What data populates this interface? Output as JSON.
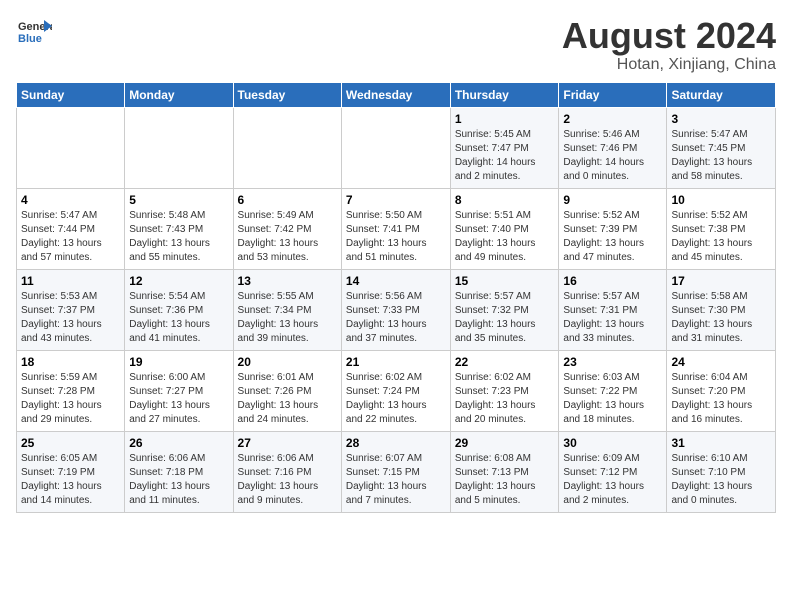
{
  "header": {
    "logo_general": "General",
    "logo_blue": "Blue",
    "title": "August 2024",
    "subtitle": "Hotan, Xinjiang, China"
  },
  "days_of_week": [
    "Sunday",
    "Monday",
    "Tuesday",
    "Wednesday",
    "Thursday",
    "Friday",
    "Saturday"
  ],
  "weeks": [
    [
      {
        "day": "",
        "info": ""
      },
      {
        "day": "",
        "info": ""
      },
      {
        "day": "",
        "info": ""
      },
      {
        "day": "",
        "info": ""
      },
      {
        "day": "1",
        "info": "Sunrise: 5:45 AM\nSunset: 7:47 PM\nDaylight: 14 hours\nand 2 minutes."
      },
      {
        "day": "2",
        "info": "Sunrise: 5:46 AM\nSunset: 7:46 PM\nDaylight: 14 hours\nand 0 minutes."
      },
      {
        "day": "3",
        "info": "Sunrise: 5:47 AM\nSunset: 7:45 PM\nDaylight: 13 hours\nand 58 minutes."
      }
    ],
    [
      {
        "day": "4",
        "info": "Sunrise: 5:47 AM\nSunset: 7:44 PM\nDaylight: 13 hours\nand 57 minutes."
      },
      {
        "day": "5",
        "info": "Sunrise: 5:48 AM\nSunset: 7:43 PM\nDaylight: 13 hours\nand 55 minutes."
      },
      {
        "day": "6",
        "info": "Sunrise: 5:49 AM\nSunset: 7:42 PM\nDaylight: 13 hours\nand 53 minutes."
      },
      {
        "day": "7",
        "info": "Sunrise: 5:50 AM\nSunset: 7:41 PM\nDaylight: 13 hours\nand 51 minutes."
      },
      {
        "day": "8",
        "info": "Sunrise: 5:51 AM\nSunset: 7:40 PM\nDaylight: 13 hours\nand 49 minutes."
      },
      {
        "day": "9",
        "info": "Sunrise: 5:52 AM\nSunset: 7:39 PM\nDaylight: 13 hours\nand 47 minutes."
      },
      {
        "day": "10",
        "info": "Sunrise: 5:52 AM\nSunset: 7:38 PM\nDaylight: 13 hours\nand 45 minutes."
      }
    ],
    [
      {
        "day": "11",
        "info": "Sunrise: 5:53 AM\nSunset: 7:37 PM\nDaylight: 13 hours\nand 43 minutes."
      },
      {
        "day": "12",
        "info": "Sunrise: 5:54 AM\nSunset: 7:36 PM\nDaylight: 13 hours\nand 41 minutes."
      },
      {
        "day": "13",
        "info": "Sunrise: 5:55 AM\nSunset: 7:34 PM\nDaylight: 13 hours\nand 39 minutes."
      },
      {
        "day": "14",
        "info": "Sunrise: 5:56 AM\nSunset: 7:33 PM\nDaylight: 13 hours\nand 37 minutes."
      },
      {
        "day": "15",
        "info": "Sunrise: 5:57 AM\nSunset: 7:32 PM\nDaylight: 13 hours\nand 35 minutes."
      },
      {
        "day": "16",
        "info": "Sunrise: 5:57 AM\nSunset: 7:31 PM\nDaylight: 13 hours\nand 33 minutes."
      },
      {
        "day": "17",
        "info": "Sunrise: 5:58 AM\nSunset: 7:30 PM\nDaylight: 13 hours\nand 31 minutes."
      }
    ],
    [
      {
        "day": "18",
        "info": "Sunrise: 5:59 AM\nSunset: 7:28 PM\nDaylight: 13 hours\nand 29 minutes."
      },
      {
        "day": "19",
        "info": "Sunrise: 6:00 AM\nSunset: 7:27 PM\nDaylight: 13 hours\nand 27 minutes."
      },
      {
        "day": "20",
        "info": "Sunrise: 6:01 AM\nSunset: 7:26 PM\nDaylight: 13 hours\nand 24 minutes."
      },
      {
        "day": "21",
        "info": "Sunrise: 6:02 AM\nSunset: 7:24 PM\nDaylight: 13 hours\nand 22 minutes."
      },
      {
        "day": "22",
        "info": "Sunrise: 6:02 AM\nSunset: 7:23 PM\nDaylight: 13 hours\nand 20 minutes."
      },
      {
        "day": "23",
        "info": "Sunrise: 6:03 AM\nSunset: 7:22 PM\nDaylight: 13 hours\nand 18 minutes."
      },
      {
        "day": "24",
        "info": "Sunrise: 6:04 AM\nSunset: 7:20 PM\nDaylight: 13 hours\nand 16 minutes."
      }
    ],
    [
      {
        "day": "25",
        "info": "Sunrise: 6:05 AM\nSunset: 7:19 PM\nDaylight: 13 hours\nand 14 minutes."
      },
      {
        "day": "26",
        "info": "Sunrise: 6:06 AM\nSunset: 7:18 PM\nDaylight: 13 hours\nand 11 minutes."
      },
      {
        "day": "27",
        "info": "Sunrise: 6:06 AM\nSunset: 7:16 PM\nDaylight: 13 hours\nand 9 minutes."
      },
      {
        "day": "28",
        "info": "Sunrise: 6:07 AM\nSunset: 7:15 PM\nDaylight: 13 hours\nand 7 minutes."
      },
      {
        "day": "29",
        "info": "Sunrise: 6:08 AM\nSunset: 7:13 PM\nDaylight: 13 hours\nand 5 minutes."
      },
      {
        "day": "30",
        "info": "Sunrise: 6:09 AM\nSunset: 7:12 PM\nDaylight: 13 hours\nand 2 minutes."
      },
      {
        "day": "31",
        "info": "Sunrise: 6:10 AM\nSunset: 7:10 PM\nDaylight: 13 hours\nand 0 minutes."
      }
    ]
  ]
}
